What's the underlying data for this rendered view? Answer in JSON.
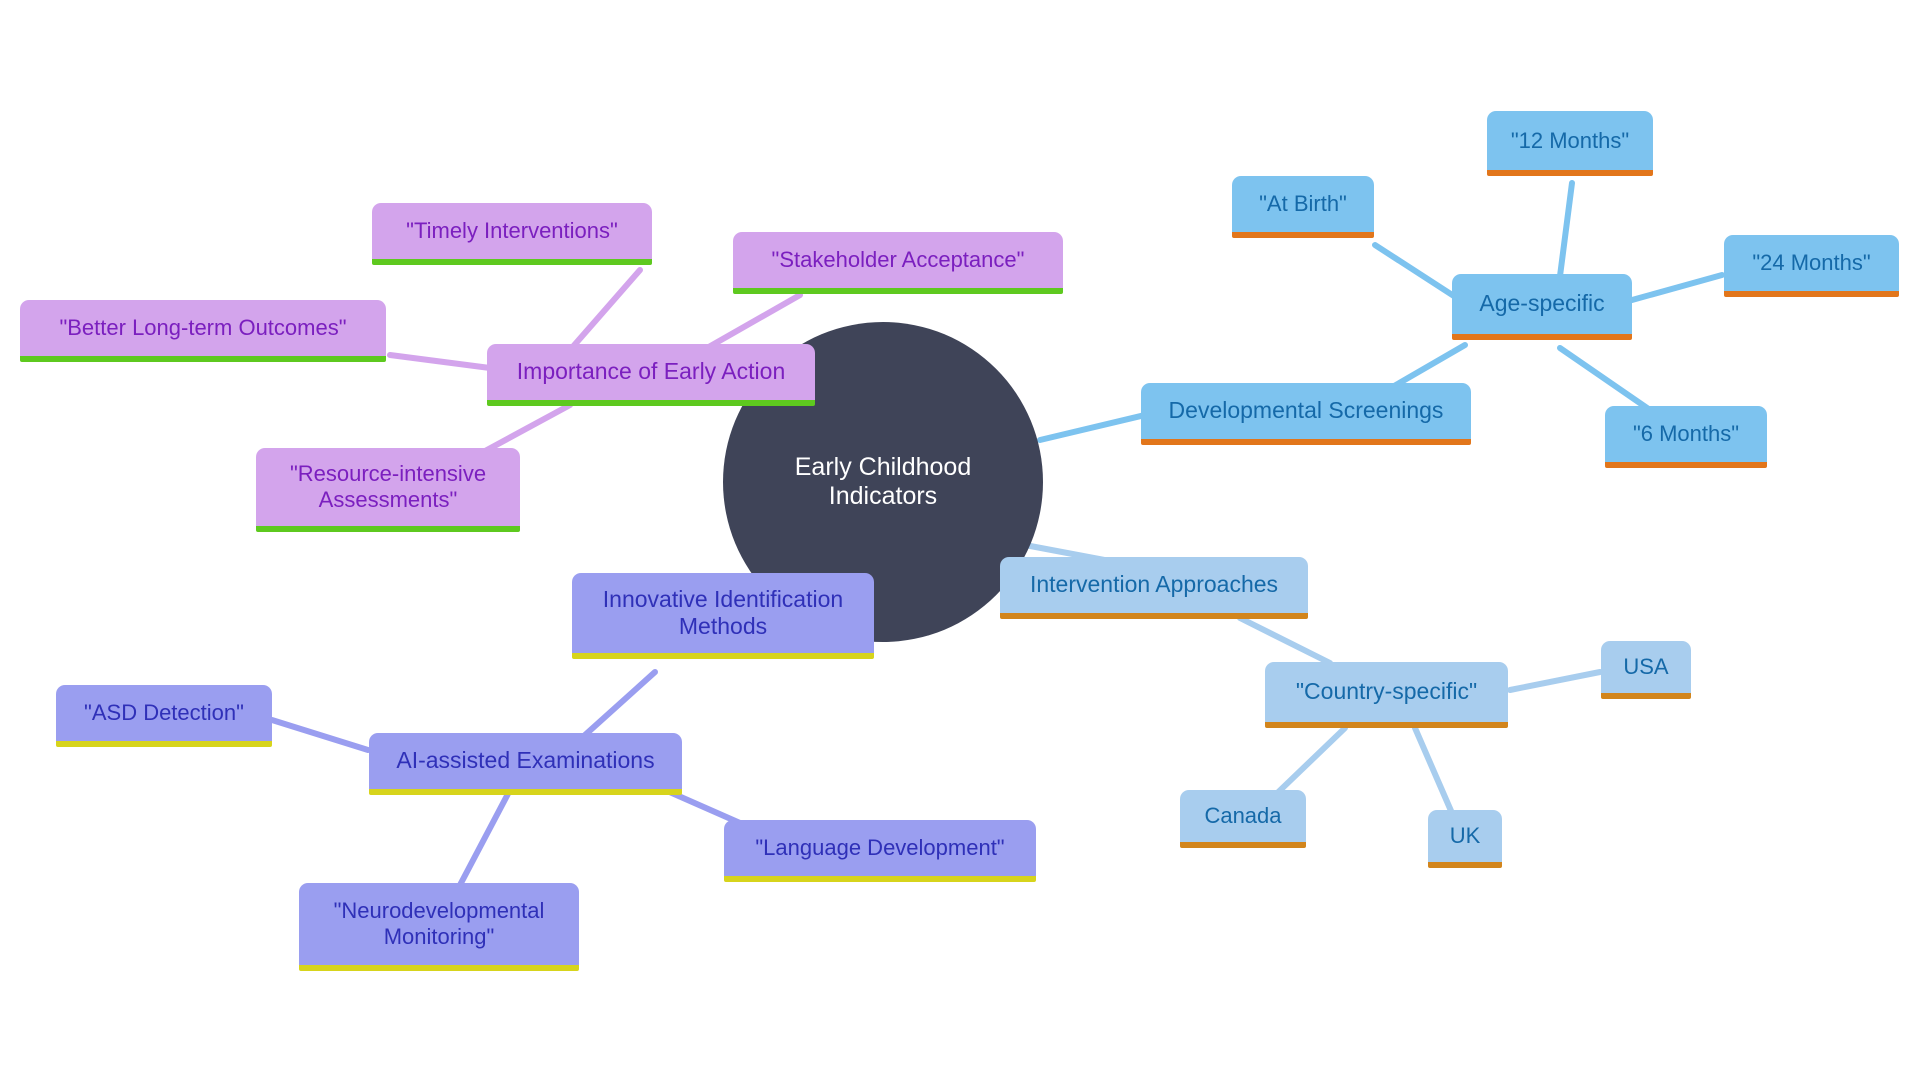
{
  "diagram": {
    "title": "Early Childhood Indicators",
    "type": "mind-map",
    "background": "#ffffff",
    "palette": {
      "root_fill": "#3f4458",
      "root_text": "#ffffff",
      "purple_fill": "#d3a4ec",
      "purple_text": "#7b1fbf",
      "purple_accent": "#5ec91f",
      "blue_fill": "#7dc3ef",
      "blue_text": "#1569a8",
      "blue_accent": "#e2761b",
      "blue_pale_fill": "#a8cdee",
      "periwinkle_fill": "#9a9ef0",
      "periwinkle_text": "#2f30b8",
      "periwinkle_accent": "#d7d41c"
    }
  },
  "root": {
    "label": "Early Childhood Indicators"
  },
  "branches": [
    {
      "id": "importance-of-early-action",
      "label": "Importance of Early Action",
      "color_group": "purple",
      "children": [
        {
          "id": "timely-interventions",
          "label": "\"Timely Interventions\""
        },
        {
          "id": "stakeholder-acceptance",
          "label": "\"Stakeholder Acceptance\""
        },
        {
          "id": "better-long-term-outcomes",
          "label": "\"Better Long-term Outcomes\""
        },
        {
          "id": "resource-intensive-assessments",
          "label": "\"Resource-intensive\nAssessments\""
        }
      ]
    },
    {
      "id": "developmental-screenings",
      "label": "Developmental Screenings",
      "color_group": "blue",
      "children": [
        {
          "id": "age-specific",
          "label": "Age-specific",
          "children": [
            {
              "id": "at-birth",
              "label": "\"At Birth\""
            },
            {
              "id": "twelve-months",
              "label": "\"12 Months\""
            },
            {
              "id": "twenty-four-months",
              "label": "\"24 Months\""
            },
            {
              "id": "six-months",
              "label": "\"6 Months\""
            }
          ]
        }
      ]
    },
    {
      "id": "intervention-approaches",
      "label": "Intervention Approaches",
      "color_group": "blue-pale",
      "children": [
        {
          "id": "country-specific",
          "label": "\"Country-specific\"",
          "children": [
            {
              "id": "usa",
              "label": "USA"
            },
            {
              "id": "canada",
              "label": "Canada"
            },
            {
              "id": "uk",
              "label": "UK"
            }
          ]
        }
      ]
    },
    {
      "id": "innovative-identification-methods",
      "label": "Innovative Identification\nMethods",
      "color_group": "periwinkle",
      "children": [
        {
          "id": "ai-assisted-examinations",
          "label": "AI-assisted Examinations",
          "children": [
            {
              "id": "asd-detection",
              "label": "\"ASD Detection\""
            },
            {
              "id": "language-development",
              "label": "\"Language Development\""
            },
            {
              "id": "neurodevelopmental-monitoring",
              "label": "\"Neurodevelopmental\nMonitoring\""
            }
          ]
        }
      ]
    }
  ]
}
